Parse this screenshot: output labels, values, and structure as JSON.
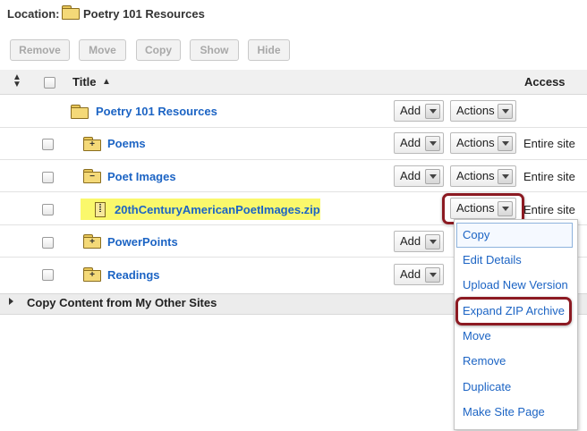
{
  "location": {
    "label": "Location:",
    "name": "Poetry 101 Resources"
  },
  "toolbar": {
    "remove": "Remove",
    "move": "Move",
    "copy": "Copy",
    "show": "Show",
    "hide": "Hide"
  },
  "table_header": {
    "title": "Title",
    "access": "Access"
  },
  "rows": [
    {
      "title": "Poetry 101 Resources",
      "add": "Add",
      "actions": "Actions",
      "access": ""
    },
    {
      "title": "Poems",
      "add": "Add",
      "actions": "Actions",
      "access": "Entire site"
    },
    {
      "title": "Poet Images",
      "add": "Add",
      "actions": "Actions",
      "access": "Entire site"
    },
    {
      "title": "20thCenturyAmericanPoetImages.zip",
      "add": "",
      "actions": "Actions",
      "access": "Entire site"
    },
    {
      "title": "PowerPoints",
      "add": "Add",
      "actions": "",
      "access": ""
    },
    {
      "title": "Readings",
      "add": "Add",
      "actions": "",
      "access": ""
    }
  ],
  "copy_section": {
    "label": "Copy Content from My Other Sites"
  },
  "actions_menu": {
    "items": [
      "Copy",
      "Edit Details",
      "Upload New Version",
      "Expand ZIP Archive",
      "Move",
      "Remove",
      "Duplicate",
      "Make Site Page"
    ]
  },
  "colors": {
    "link": "#1c64c4",
    "highlight": "#faf86b",
    "callout": "#8c1a22"
  },
  "icons": [
    "folder-icon",
    "folder-plus-icon",
    "folder-minus-icon",
    "zip-file-icon",
    "sort-icon",
    "expand-arrow-icon",
    "dropdown-arrow-icon"
  ]
}
